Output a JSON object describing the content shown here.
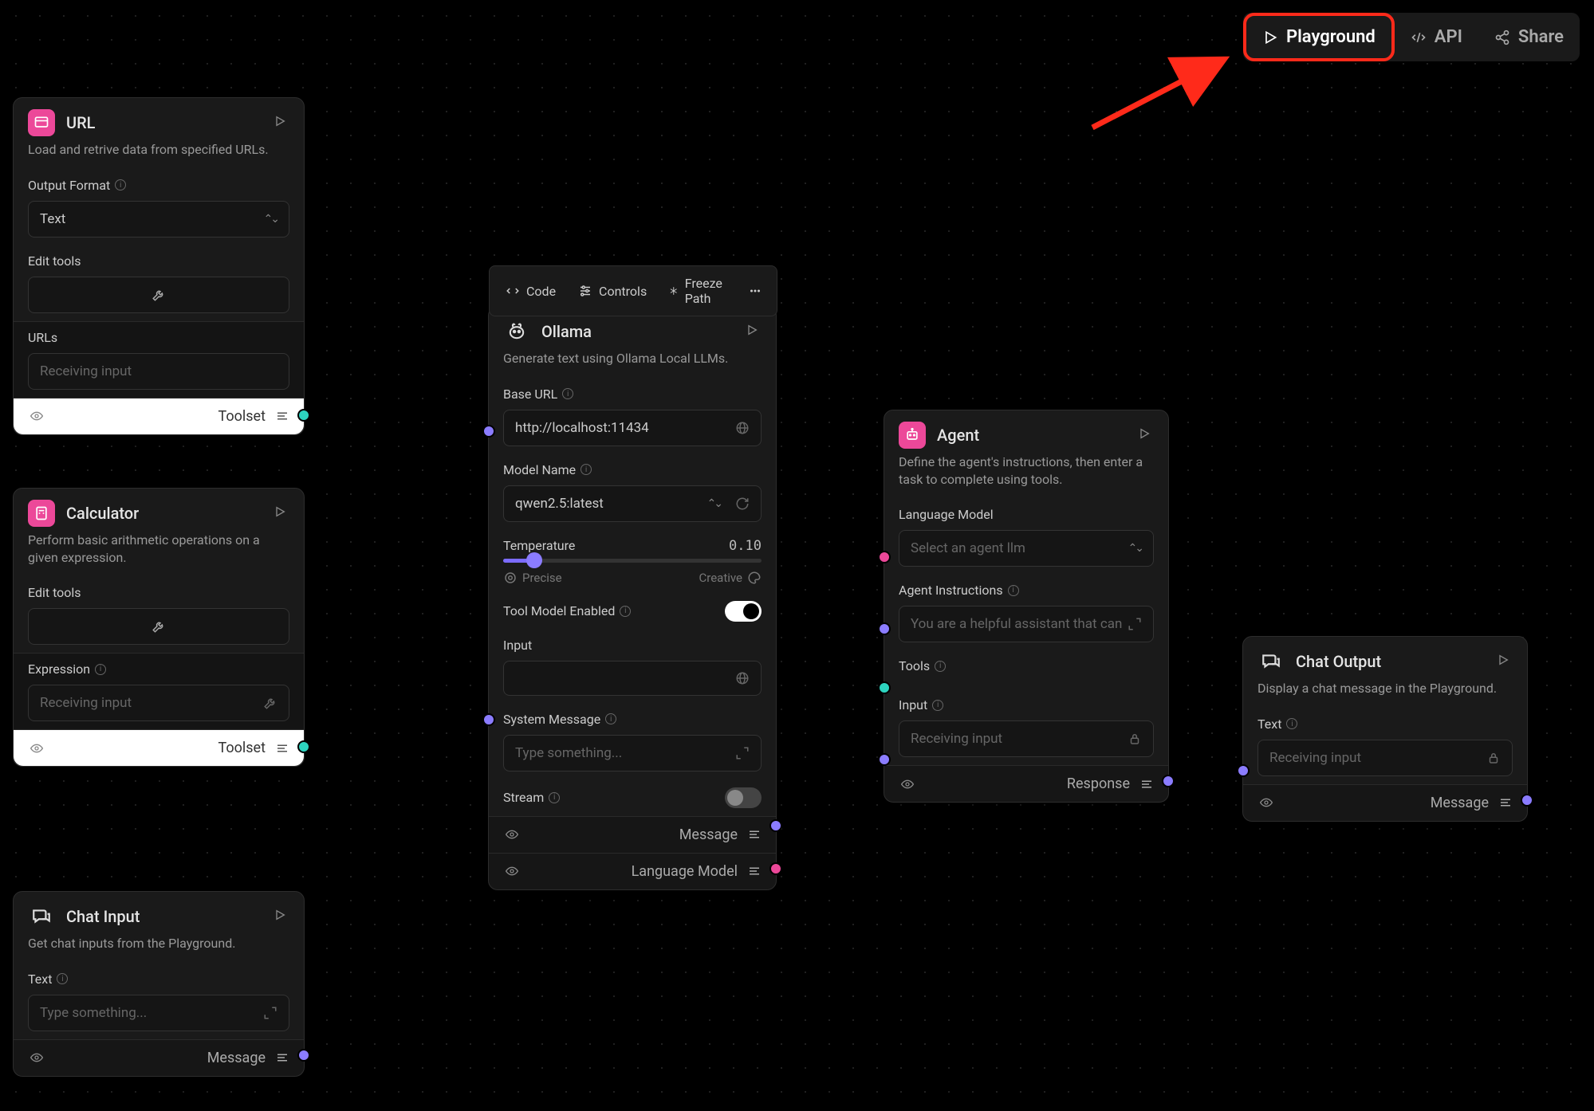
{
  "toolbar": {
    "playground": "Playground",
    "api": "API",
    "share": "Share"
  },
  "node_topbar": {
    "code": "Code",
    "controls": "Controls",
    "freeze": "Freeze Path"
  },
  "url_node": {
    "title": "URL",
    "desc": "Load and retrive data from specified URLs.",
    "output_format_label": "Output Format",
    "output_format_value": "Text",
    "edit_tools_label": "Edit tools",
    "urls_label": "URLs",
    "urls_placeholder": "Receiving input",
    "footer_label": "Toolset"
  },
  "calc_node": {
    "title": "Calculator",
    "desc": "Perform basic arithmetic operations on a given expression.",
    "edit_tools_label": "Edit tools",
    "expression_label": "Expression",
    "expression_placeholder": "Receiving input",
    "footer_label": "Toolset"
  },
  "chat_input_node": {
    "title": "Chat Input",
    "desc": "Get chat inputs from the Playground.",
    "text_label": "Text",
    "text_placeholder": "Type something...",
    "footer_label": "Message"
  },
  "ollama_node": {
    "title": "Ollama",
    "desc": "Generate text using Ollama Local LLMs.",
    "base_url_label": "Base URL",
    "base_url_value": "http://localhost:11434",
    "model_label": "Model Name",
    "model_value": "qwen2.5:latest",
    "temperature_label": "Temperature",
    "temperature_value": "0.10",
    "precise": "Precise",
    "creative": "Creative",
    "tool_model_label": "Tool Model Enabled",
    "input_label": "Input",
    "system_label": "System Message",
    "system_placeholder": "Type something...",
    "stream_label": "Stream",
    "footer_message": "Message",
    "footer_lang": "Language Model"
  },
  "agent_node": {
    "title": "Agent",
    "desc": "Define the agent's instructions, then enter a task to complete using tools.",
    "lang_model_label": "Language Model",
    "lang_model_placeholder": "Select an agent llm",
    "instructions_label": "Agent Instructions",
    "instructions_value": "You are a helpful assistant that can",
    "tools_label": "Tools",
    "input_label": "Input",
    "input_placeholder": "Receiving input",
    "footer_label": "Response"
  },
  "chat_output_node": {
    "title": "Chat Output",
    "desc": "Display a chat message in the Playground.",
    "text_label": "Text",
    "text_placeholder": "Receiving input",
    "footer_label": "Message"
  }
}
